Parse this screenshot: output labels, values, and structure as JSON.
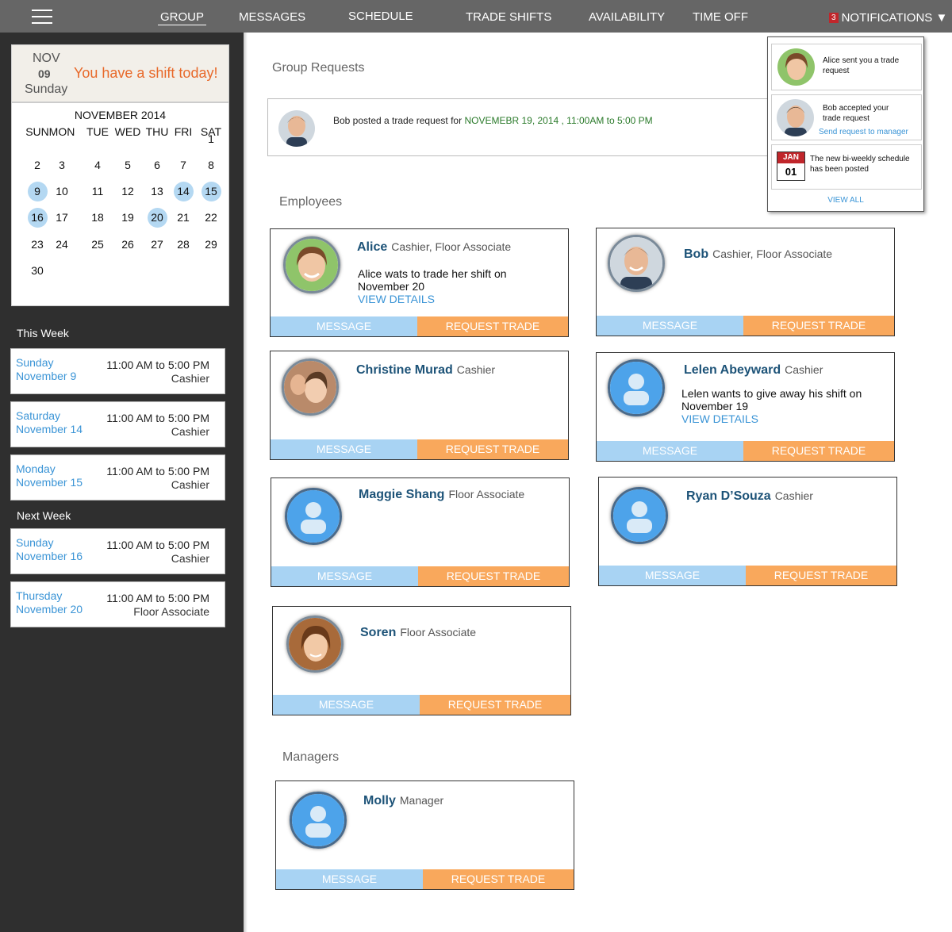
{
  "nav": {
    "items": [
      "GROUP",
      "MESSAGES",
      "SCHEDULE",
      "TRADE SHIFTS",
      "AVAILABILITY",
      "TIME OFF"
    ],
    "active": "GROUP",
    "notifications_label": "NOTIFICATIONS ▼",
    "notifications_count": "3"
  },
  "today": {
    "month": "NOV",
    "day": "09",
    "weekday": "Sunday",
    "message": "You have a shift today!"
  },
  "calendar": {
    "title": "NOVEMBER 2014",
    "weekdays": [
      "SUN",
      "MON",
      "TUE",
      "WED",
      "THU",
      "FRI",
      "SAT"
    ],
    "weeks": [
      [
        "",
        "",
        "",
        "",
        "",
        "",
        "1"
      ],
      [
        "2",
        "3",
        "4",
        "5",
        "6",
        "7",
        "8"
      ],
      [
        "9",
        "10",
        "11",
        "12",
        "13",
        "14",
        "15"
      ],
      [
        "16",
        "17",
        "18",
        "19",
        "20",
        "21",
        "22"
      ],
      [
        "23",
        "24",
        "25",
        "26",
        "27",
        "28",
        "29"
      ],
      [
        "30",
        "",
        "",
        "",
        "",
        "",
        ""
      ]
    ],
    "highlighted": [
      "9",
      "14",
      "15",
      "16",
      "20"
    ]
  },
  "this_week": {
    "title": "This Week",
    "shifts": [
      {
        "day": "Sunday",
        "date": "November 9",
        "time": "11:00 AM to 5:00 PM",
        "role": "Cashier"
      },
      {
        "day": "Saturday",
        "date": "November 14",
        "time": "11:00 AM to 5:00 PM",
        "role": "Cashier"
      },
      {
        "day": "Monday",
        "date": "November 15",
        "time": "11:00 AM to 5:00 PM",
        "role": "Cashier"
      }
    ]
  },
  "next_week": {
    "title": "Next Week",
    "shifts": [
      {
        "day": "Sunday",
        "date": "November 16",
        "time": "11:00 AM to 5:00 PM",
        "role": "Cashier"
      },
      {
        "day": "Thursday",
        "date": "November 20",
        "time": "11:00 AM to 5:00 PM",
        "role": "Floor Associate"
      }
    ]
  },
  "group_requests": {
    "title": "Group Requests",
    "text_prefix": "Bob posted a trade request for",
    "text_date": "NOVEMEBR 19, 2014 , 11:00AM to 5:00 PM"
  },
  "employees": {
    "title": "Employees",
    "cards": [
      {
        "name": "Alice",
        "role": "Cashier, Floor Associate",
        "message": "Alice wats to trade her shift on November 20",
        "details": "VIEW DETAILS",
        "message_btn": "MESSAGE",
        "trade_btn": "REQUEST TRADE"
      },
      {
        "name": "Bob",
        "role": "Cashier, Floor Associate",
        "message": "",
        "details": "",
        "message_btn": "MESSAGE",
        "trade_btn": "REQUEST TRADE"
      },
      {
        "name": "Christine Murad",
        "role": "Cashier",
        "message": "",
        "details": "",
        "message_btn": "MESSAGE",
        "trade_btn": "REQUEST TRADE"
      },
      {
        "name": "Lelen Abeyward",
        "role": "Cashier",
        "message": "Lelen wants to give away his shift on November 19",
        "details": "VIEW DETAILS",
        "message_btn": "MESSAGE",
        "trade_btn": "REQUEST TRADE"
      },
      {
        "name": "Maggie Shang",
        "role": "Floor Associate",
        "message": "",
        "details": "",
        "message_btn": "MESSAGE",
        "trade_btn": "REQUEST TRADE"
      },
      {
        "name": "Ryan D’Souza",
        "role": "Cashier",
        "message": "",
        "details": "",
        "message_btn": "MESSAGE",
        "trade_btn": "REQUEST TRADE"
      },
      {
        "name": "Soren",
        "role": "Floor Associate",
        "message": "",
        "details": "",
        "message_btn": "MESSAGE",
        "trade_btn": "REQUEST TRADE"
      }
    ]
  },
  "managers": {
    "title": "Managers",
    "cards": [
      {
        "name": "Molly",
        "role": "Manager",
        "message_btn": "MESSAGE",
        "trade_btn": "REQUEST TRADE"
      }
    ]
  },
  "notifications": {
    "items": [
      {
        "text": "Alice sent you a trade request",
        "link": ""
      },
      {
        "text": "Bob accepted your trade request",
        "link": "Send request to manager"
      },
      {
        "text": "The new bi-weekly schedule has been posted",
        "link": "",
        "icon_month": "JAN",
        "icon_day": "01"
      }
    ],
    "view_all": "VIEW ALL"
  },
  "colors": {
    "topbar": "#666666",
    "sidebar": "#2f2f2f",
    "accent_orange": "#e8692a",
    "link_blue": "#3a94d6",
    "name_blue": "#1d5378",
    "message_button": "#a8d3f3",
    "trade_button": "#f9a85c",
    "calendar_highlight": "#b4d8f2"
  }
}
